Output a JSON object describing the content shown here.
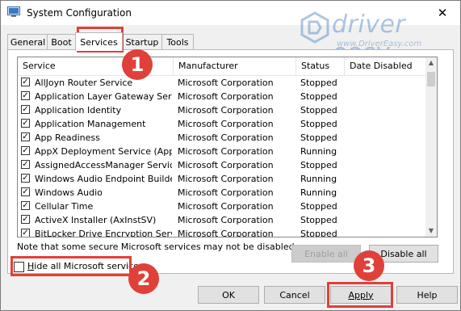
{
  "window": {
    "title": "System Configuration",
    "close_glyph": "✕"
  },
  "watermark": {
    "brand": "driver easy",
    "url": "www.DriverEasy.com"
  },
  "tabs": [
    "General",
    "Boot",
    "Services",
    "Startup",
    "Tools"
  ],
  "active_tab": "Services",
  "table": {
    "columns": [
      "Service",
      "Manufacturer",
      "Status",
      "Date Disabled"
    ],
    "rows": [
      {
        "service": "AllJoyn Router Service",
        "manufacturer": "Microsoft Corporation",
        "status": "Stopped",
        "checked": true
      },
      {
        "service": "Application Layer Gateway Service",
        "manufacturer": "Microsoft Corporation",
        "status": "Stopped",
        "checked": true
      },
      {
        "service": "Application Identity",
        "manufacturer": "Microsoft Corporation",
        "status": "Stopped",
        "checked": true
      },
      {
        "service": "Application Management",
        "manufacturer": "Microsoft Corporation",
        "status": "Stopped",
        "checked": true
      },
      {
        "service": "App Readiness",
        "manufacturer": "Microsoft Corporation",
        "status": "Stopped",
        "checked": true
      },
      {
        "service": "AppX Deployment Service (AppX...",
        "manufacturer": "Microsoft Corporation",
        "status": "Running",
        "checked": true
      },
      {
        "service": "AssignedAccessManager Service",
        "manufacturer": "Microsoft Corporation",
        "status": "Stopped",
        "checked": true
      },
      {
        "service": "Windows Audio Endpoint Builder",
        "manufacturer": "Microsoft Corporation",
        "status": "Running",
        "checked": true
      },
      {
        "service": "Windows Audio",
        "manufacturer": "Microsoft Corporation",
        "status": "Running",
        "checked": true
      },
      {
        "service": "Cellular Time",
        "manufacturer": "Microsoft Corporation",
        "status": "Stopped",
        "checked": true
      },
      {
        "service": "ActiveX Installer (AxInstSV)",
        "manufacturer": "Microsoft Corporation",
        "status": "Stopped",
        "checked": true
      },
      {
        "service": "BitLocker Drive Encryption Service",
        "manufacturer": "Microsoft Corporation",
        "status": "Stopped",
        "checked": true
      }
    ]
  },
  "note": "Note that some secure Microsoft services may not be disabled.",
  "buttons": {
    "enable_all": "Enable all",
    "disable_all": "Disable all",
    "ok": "OK",
    "cancel": "Cancel",
    "apply": "Apply",
    "help": "Help"
  },
  "hide_ms": {
    "first_letter": "H",
    "rest": "ide all Microsoft services",
    "checked": false
  },
  "callouts": {
    "one": "1",
    "two": "2",
    "three": "3"
  },
  "colors": {
    "highlight": "#e0403a",
    "watermark": "#5d8fc8"
  }
}
